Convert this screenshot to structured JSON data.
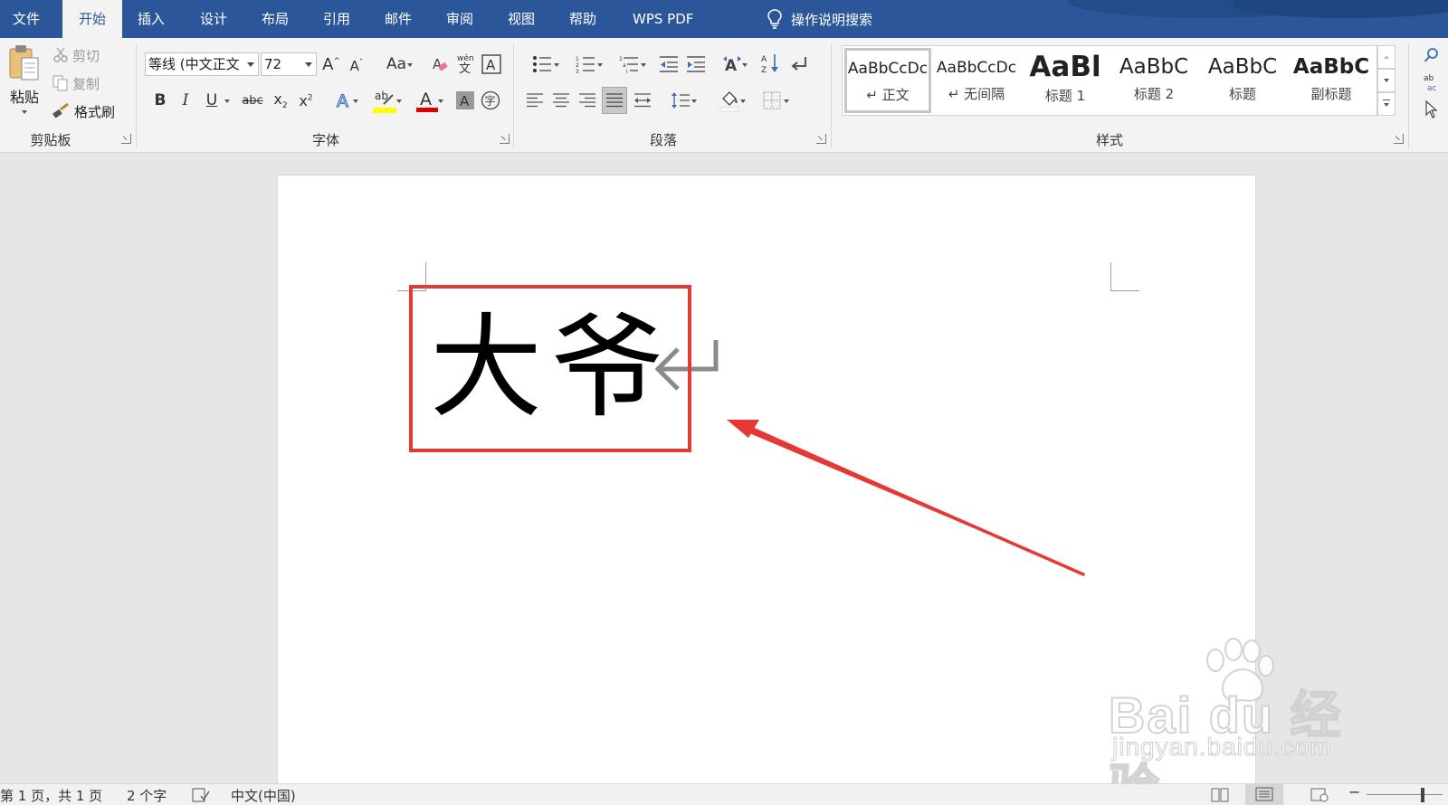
{
  "tabs": [
    "文件",
    "开始",
    "插入",
    "设计",
    "布局",
    "引用",
    "邮件",
    "审阅",
    "视图",
    "帮助",
    "WPS PDF"
  ],
  "active_tab": "开始",
  "tell_me": "操作说明搜索",
  "clipboard": {
    "paste": "粘贴",
    "cut": "剪切",
    "copy": "复制",
    "format_painter": "格式刷",
    "group_label": "剪贴板"
  },
  "font": {
    "name": "等线 (中文正文",
    "size": "72",
    "change_case": "Aa",
    "group_label": "字体"
  },
  "paragraph": {
    "group_label": "段落"
  },
  "styles": {
    "group_label": "样式",
    "items": [
      {
        "sample": "AaBbCcDc",
        "name": "↵ 正文"
      },
      {
        "sample": "AaBbCcDc",
        "name": "↵ 无间隔"
      },
      {
        "sample": "AaBl",
        "name": "标题 1"
      },
      {
        "sample": "AaBbC",
        "name": "标题 2"
      },
      {
        "sample": "AaBbC",
        "name": "标题"
      },
      {
        "sample": "AaBbC",
        "name": "副标题"
      }
    ]
  },
  "document": {
    "text": "大爷"
  },
  "watermark": {
    "main": "Bai du 经验",
    "sub": "jingyan.baidu.com"
  },
  "status": {
    "page": "第 1 页，共 1 页",
    "words": "2 个字",
    "language": "中文(中国)"
  },
  "colors": {
    "ribbon_blue": "#2b579a",
    "highlight": "#ffff00",
    "font_color": "#e00000",
    "annotation_red": "#e53935"
  }
}
